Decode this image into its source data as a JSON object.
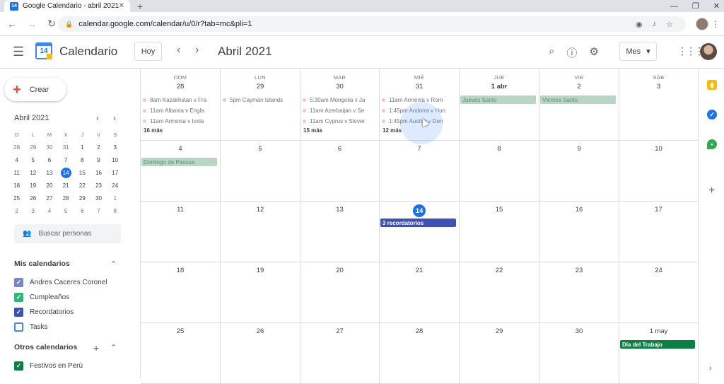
{
  "browser": {
    "tab_title": "Google Calendario - abril 2021",
    "favicon_text": "14",
    "url": "calendar.google.com/calendar/u/0/r?tab=mc&pli=1"
  },
  "header": {
    "app_name": "Calendario",
    "logo_day": "14",
    "today_label": "Hoy",
    "month_title": "Abril 2021",
    "view_label": "Mes"
  },
  "sidebar": {
    "create_label": "Crear",
    "mini_month": "Abril 2021",
    "mini_day_headers": [
      "D",
      "L",
      "M",
      "X",
      "J",
      "V",
      "S"
    ],
    "mini_days": [
      [
        "28",
        "29",
        "30",
        "31",
        "1",
        "2",
        "3"
      ],
      [
        "4",
        "5",
        "6",
        "7",
        "8",
        "9",
        "10"
      ],
      [
        "11",
        "12",
        "13",
        "14",
        "15",
        "16",
        "17"
      ],
      [
        "18",
        "19",
        "20",
        "21",
        "22",
        "23",
        "24"
      ],
      [
        "25",
        "26",
        "27",
        "28",
        "29",
        "30",
        "1"
      ],
      [
        "2",
        "3",
        "4",
        "5",
        "6",
        "7",
        "8"
      ]
    ],
    "search_people": "Buscar personas",
    "my_calendars_title": "Mis calendarios",
    "my_calendars": [
      {
        "label": "Andres Caceres Coronel",
        "color": "#7986cb",
        "checked": true
      },
      {
        "label": "Cumpleaños",
        "color": "#33b679",
        "checked": true
      },
      {
        "label": "Recordatorios",
        "color": "#3f51b5",
        "checked": true
      },
      {
        "label": "Tasks",
        "color": "#4285f4",
        "checked": false
      }
    ],
    "other_calendars_title": "Otros calendarios",
    "other_calendars": [
      {
        "label": "Festivos en Perú",
        "color": "#0b8043",
        "checked": true
      }
    ]
  },
  "calendar": {
    "weekday_headers": [
      "DOM",
      "LUN",
      "MAR",
      "MIÉ",
      "JUE",
      "VIE",
      "SÁB"
    ],
    "weeks": [
      [
        "28",
        "29",
        "30",
        "31",
        "1 abr",
        "2",
        "3"
      ],
      [
        "4",
        "5",
        "6",
        "7",
        "8",
        "9",
        "10"
      ],
      [
        "11",
        "12",
        "13",
        "14",
        "15",
        "16",
        "17"
      ],
      [
        "18",
        "19",
        "20",
        "21",
        "22",
        "23",
        "24"
      ],
      [
        "25",
        "26",
        "27",
        "28",
        "29",
        "30",
        "1 may"
      ]
    ],
    "today": "14",
    "events": {
      "w0d0": [
        "8am Kazakhstan v Fra",
        "11am Albania v Engla",
        "11am Armenia v Icela"
      ],
      "w0d0_more": "16 más",
      "w0d1": [
        "5pm Cayman Islands"
      ],
      "w0d2": [
        "5:30am Mongolia v Ja",
        "11am Azerbaijan v Se",
        "11am Cyprus v Slover"
      ],
      "w0d2_more": "15 más",
      "w0d3": [
        "11am Armenia v Rom",
        "1:45pm Andorra v Hun",
        "1:45pm Austria v Den"
      ],
      "w0d3_more": "12 más",
      "w0d4_bar": "Jueves Santo",
      "w0d5_bar": "Viernes Santo",
      "w1d0_bar": "Domingo de Pascua",
      "w2d3_bar": "3 recordatorios",
      "w4d6_bar": "Día del Trabajo"
    },
    "colors": {
      "holiday_faded": "#b9d5c6",
      "holiday": "#0b8043",
      "reminder": "#3f51b5",
      "today_blue": "#1a73e8"
    }
  },
  "icons": {
    "search": "search-icon",
    "help": "help-icon",
    "settings": "gear-icon",
    "apps": "apps-grid-icon"
  }
}
